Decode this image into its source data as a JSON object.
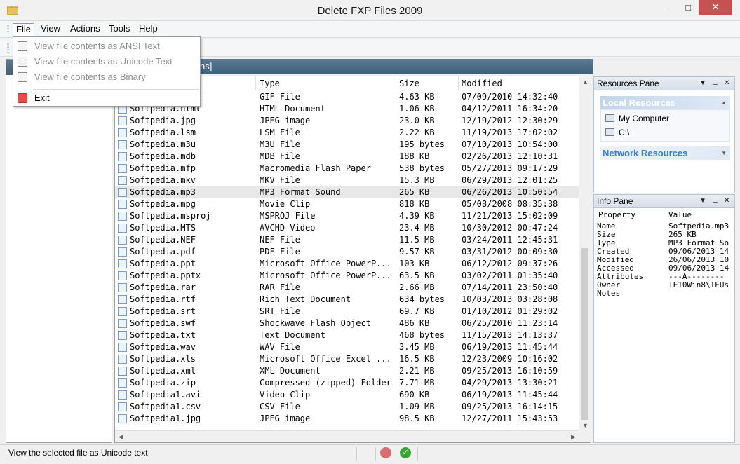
{
  "window": {
    "title": "Delete FXP Files 2009",
    "min_glyph": "—",
    "max_glyph": "□",
    "close_glyph": "✕"
  },
  "menubar": {
    "file": "File",
    "view": "View",
    "actions": "Actions",
    "tools": "Tools",
    "help": "Help"
  },
  "file_menu": {
    "items": [
      {
        "label": "View file contents as ANSI Text",
        "enabled": false,
        "icon": "ansi-text-icon"
      },
      {
        "label": "View file contents as Unicode Text",
        "enabled": false,
        "icon": "unicode-text-icon"
      },
      {
        "label": "View file contents as Binary",
        "enabled": false,
        "icon": "binary-icon"
      },
      {
        "label": "Exit",
        "enabled": true,
        "icon": "exit-icon"
      }
    ]
  },
  "path_bar": {
    "text": "ns]"
  },
  "file_list": {
    "columns": {
      "type": "Type",
      "size": "Size",
      "modified": "Modified"
    },
    "rows": [
      {
        "name": "",
        "type": "GIF File",
        "size": "4.63 KB",
        "modified": "07/09/2010 14:32:40"
      },
      {
        "name": "Softpedia.html",
        "type": "HTML Document",
        "size": "1.06 KB",
        "modified": "04/12/2011 16:34:20"
      },
      {
        "name": "Softpedia.jpg",
        "type": "JPEG image",
        "size": "23.0 KB",
        "modified": "12/19/2012 12:30:29"
      },
      {
        "name": "Softpedia.lsm",
        "type": "LSM File",
        "size": "2.22 KB",
        "modified": "11/19/2013 17:02:02"
      },
      {
        "name": "Softpedia.m3u",
        "type": "M3U File",
        "size": "195 bytes",
        "modified": "07/10/2013 10:54:00"
      },
      {
        "name": "Softpedia.mdb",
        "type": "MDB File",
        "size": "188 KB",
        "modified": "02/26/2013 12:10:31"
      },
      {
        "name": "Softpedia.mfp",
        "type": "Macromedia Flash Paper",
        "size": "538 bytes",
        "modified": "05/27/2013 09:17:29"
      },
      {
        "name": "Softpedia.mkv",
        "type": "MKV File",
        "size": "15.3 MB",
        "modified": "06/29/2013 12:01:25"
      },
      {
        "name": "Softpedia.mp3",
        "type": "MP3 Format Sound",
        "size": "265 KB",
        "modified": "06/26/2013 10:50:54"
      },
      {
        "name": "Softpedia.mpg",
        "type": "Movie Clip",
        "size": "818 KB",
        "modified": "05/08/2008 08:35:38"
      },
      {
        "name": "Softpedia.msproj",
        "type": "MSPROJ File",
        "size": "4.39 KB",
        "modified": "11/21/2013 15:02:09"
      },
      {
        "name": "Softpedia.MTS",
        "type": "AVCHD Video",
        "size": "23.4 MB",
        "modified": "10/30/2012 00:47:24"
      },
      {
        "name": "Softpedia.NEF",
        "type": "NEF File",
        "size": "11.5 MB",
        "modified": "03/24/2011 12:45:31"
      },
      {
        "name": "Softpedia.pdf",
        "type": "PDF File",
        "size": "9.57 KB",
        "modified": "03/31/2012 00:09:30"
      },
      {
        "name": "Softpedia.ppt",
        "type": "Microsoft Office PowerP...",
        "size": "103 KB",
        "modified": "06/12/2012 09:37:26"
      },
      {
        "name": "Softpedia.pptx",
        "type": "Microsoft Office PowerP...",
        "size": "63.5 KB",
        "modified": "03/02/2011 01:35:40"
      },
      {
        "name": "Softpedia.rar",
        "type": "RAR File",
        "size": "2.66 MB",
        "modified": "07/14/2011 23:50:40"
      },
      {
        "name": "Softpedia.rtf",
        "type": "Rich Text Document",
        "size": "634 bytes",
        "modified": "10/03/2013 03:28:08"
      },
      {
        "name": "Softpedia.srt",
        "type": "SRT File",
        "size": "69.7 KB",
        "modified": "01/10/2012 01:29:02"
      },
      {
        "name": "Softpedia.swf",
        "type": "Shockwave Flash Object",
        "size": "486 KB",
        "modified": "06/25/2010 11:23:14"
      },
      {
        "name": "Softpedia.txt",
        "type": "Text Document",
        "size": "468 bytes",
        "modified": "11/15/2013 14:13:37"
      },
      {
        "name": "Softpedia.wav",
        "type": "WAV File",
        "size": "3.45 MB",
        "modified": "06/19/2013 11:45:44"
      },
      {
        "name": "Softpedia.xls",
        "type": "Microsoft Office Excel ...",
        "size": "16.5 KB",
        "modified": "12/23/2009 10:16:02"
      },
      {
        "name": "Softpedia.xml",
        "type": "XML Document",
        "size": "2.21 MB",
        "modified": "09/25/2013 16:10:59"
      },
      {
        "name": "Softpedia.zip",
        "type": "Compressed (zipped) Folder",
        "size": "7.71 MB",
        "modified": "04/29/2013 13:30:21"
      },
      {
        "name": "Softpedia1.avi",
        "type": "Video Clip",
        "size": "690 KB",
        "modified": "06/19/2013 11:45:44"
      },
      {
        "name": "Softpedia1.csv",
        "type": "CSV File",
        "size": "1.09 MB",
        "modified": "09/25/2013 16:14:15"
      },
      {
        "name": "Softpedia1.jpg",
        "type": "JPEG image",
        "size": "98.5 KB",
        "modified": "12/27/2011 15:43:53"
      }
    ]
  },
  "resources_pane": {
    "title": "Resources Pane",
    "local_group": "Local Resources",
    "local_items": [
      "My Computer",
      "C:\\"
    ],
    "network_group": "Network Resources"
  },
  "info_pane": {
    "title": "Info Pane",
    "col_property": "Property",
    "col_value": "Value",
    "rows": [
      {
        "k": "Name",
        "v": "Softpedia.mp3"
      },
      {
        "k": "Size",
        "v": "265 KB"
      },
      {
        "k": "Type",
        "v": "MP3 Format So"
      },
      {
        "k": "Created",
        "v": "09/06/2013 14"
      },
      {
        "k": "Modified",
        "v": "26/06/2013 10"
      },
      {
        "k": "Accessed",
        "v": "09/06/2013 14"
      },
      {
        "k": "Attributes",
        "v": "---A--------"
      },
      {
        "k": "Owner",
        "v": "IE10Win8\\IEUs"
      },
      {
        "k": "Notes",
        "v": ""
      }
    ]
  },
  "pane_buttons": {
    "dropdown": "▼",
    "pin": "📌",
    "close": "✕"
  },
  "scroll": {
    "up": "▲",
    "down": "▼",
    "left": "◀",
    "right": "▶"
  },
  "statusbar": {
    "text": "View the selected file as Unicode text",
    "ok": "✓"
  }
}
